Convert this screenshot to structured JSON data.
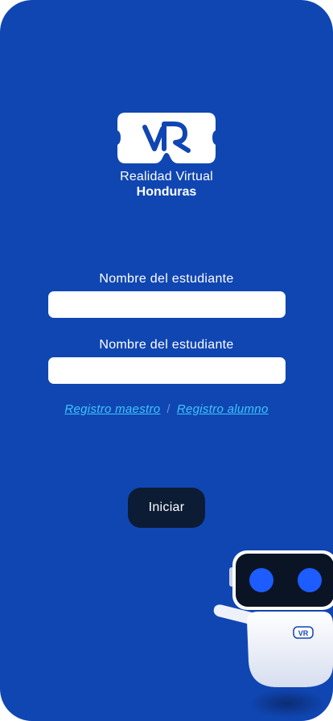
{
  "brand": {
    "logo_monogram": "VR",
    "line1": "Realidad Virtual",
    "line2": "Honduras"
  },
  "form": {
    "field1": {
      "label": "Nombre del estudiante",
      "value": "",
      "placeholder": ""
    },
    "field2": {
      "label": "Nombre del estudiante",
      "value": "",
      "placeholder": ""
    }
  },
  "links": {
    "teacher": "Registro maestro",
    "separator": "/",
    "student": "Registro alumno"
  },
  "actions": {
    "start": "Iniciar"
  },
  "mascot": {
    "badge": "VR"
  },
  "colors": {
    "background": "#1046b2",
    "link": "#3ec6ff",
    "button": "#0c1c35",
    "input": "#ffffff"
  }
}
